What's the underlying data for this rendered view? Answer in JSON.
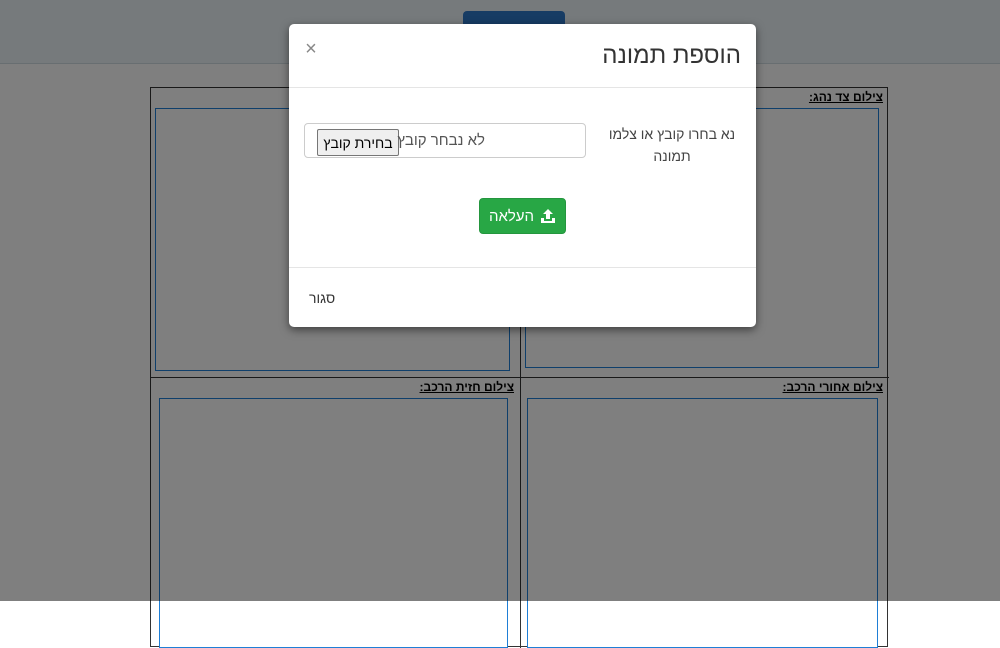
{
  "page": {
    "header_button_label": "",
    "cells": [
      {
        "title": "צילום צד נהג:"
      },
      {
        "title": ""
      },
      {
        "title": "צילום אחורי הרכב:"
      },
      {
        "title": "צילום חזית הרכב:"
      }
    ]
  },
  "modal": {
    "title": "הוספת תמונה",
    "close_symbol": "×",
    "close_icon": "close-icon",
    "field_label": "נא בחרו קובץ או צלמו תמונה",
    "file_input": {
      "button_label": "בחירת קובץ",
      "status_text": "לא נבחר קובץ"
    },
    "upload_button": {
      "label": "העלאה",
      "icon": "upload-icon"
    },
    "footer_close_label": "סגור"
  },
  "colors": {
    "success": "#28a745",
    "primary": "#2f78c8",
    "frame_border": "#1f7fd6",
    "backdrop": "rgba(0,0,0,0.5)"
  }
}
